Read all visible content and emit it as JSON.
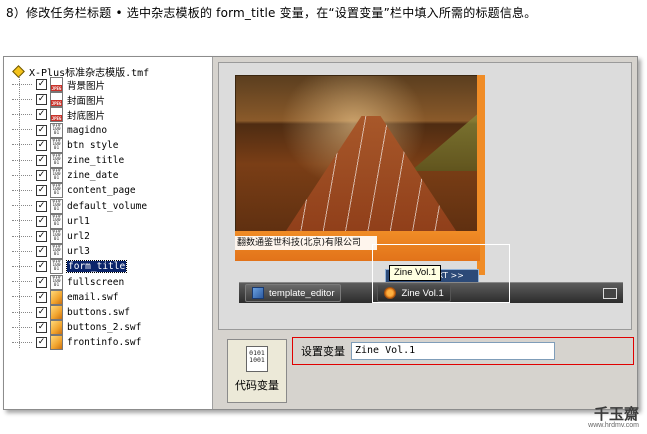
{
  "caption": "8）修改任务栏标题 • 选中杂志模板的  form_title 变量，在“设置变量”栏中填入所需的标题信息。",
  "tree": {
    "root": "X-Plus标准杂志模版.tmf",
    "items": [
      {
        "label": "背景图片",
        "icon": "image-file-icon",
        "kind": "img"
      },
      {
        "label": "封面图片",
        "icon": "image-file-icon",
        "kind": "img"
      },
      {
        "label": "封底图片",
        "icon": "image-file-icon",
        "kind": "img"
      },
      {
        "label": "magidno",
        "icon": "code-variable-icon",
        "kind": "code"
      },
      {
        "label": "btn style",
        "icon": "code-variable-icon",
        "kind": "code"
      },
      {
        "label": "zine_title",
        "icon": "code-variable-icon",
        "kind": "code"
      },
      {
        "label": "zine_date",
        "icon": "code-variable-icon",
        "kind": "code"
      },
      {
        "label": "content_page",
        "icon": "code-variable-icon",
        "kind": "code"
      },
      {
        "label": "default_volume",
        "icon": "code-variable-icon",
        "kind": "code"
      },
      {
        "label": "url1",
        "icon": "code-variable-icon",
        "kind": "code"
      },
      {
        "label": "url2",
        "icon": "code-variable-icon",
        "kind": "code"
      },
      {
        "label": "url3",
        "icon": "code-variable-icon",
        "kind": "code"
      },
      {
        "label": "form_title",
        "icon": "code-variable-icon",
        "kind": "code",
        "selected": true
      },
      {
        "label": "fullscreen",
        "icon": "code-variable-icon",
        "kind": "code"
      },
      {
        "label": "email.swf",
        "icon": "swf-file-icon",
        "kind": "swf"
      },
      {
        "label": "buttons.swf",
        "icon": "swf-file-icon",
        "kind": "swf"
      },
      {
        "label": "buttons_2.swf",
        "icon": "swf-file-icon",
        "kind": "swf"
      },
      {
        "label": "frontinfo.swf",
        "icon": "swf-file-icon",
        "kind": "swf"
      }
    ]
  },
  "preview": {
    "cover_text": "翻数通鉴世科技(北京)有限公司",
    "next_label": "下一页 NEXT >>",
    "tooltip": "Zine Vol.1",
    "taskbar": [
      {
        "label": "template_editor",
        "icon": "window-icon"
      },
      {
        "label": "Zine Vol.1",
        "icon": "zine-icon"
      }
    ]
  },
  "editor": {
    "code_icon_text": "0101\n1001",
    "var_button_label": "代码变量",
    "set_label": "设置变量",
    "value": "Zine Vol.1"
  },
  "watermark": {
    "logo": "千玉齋",
    "url": "www.hrdmv.com"
  },
  "colors": {
    "selection": "#0a246a",
    "highlight": "#e00000",
    "brand_orange": "#f08c26"
  }
}
